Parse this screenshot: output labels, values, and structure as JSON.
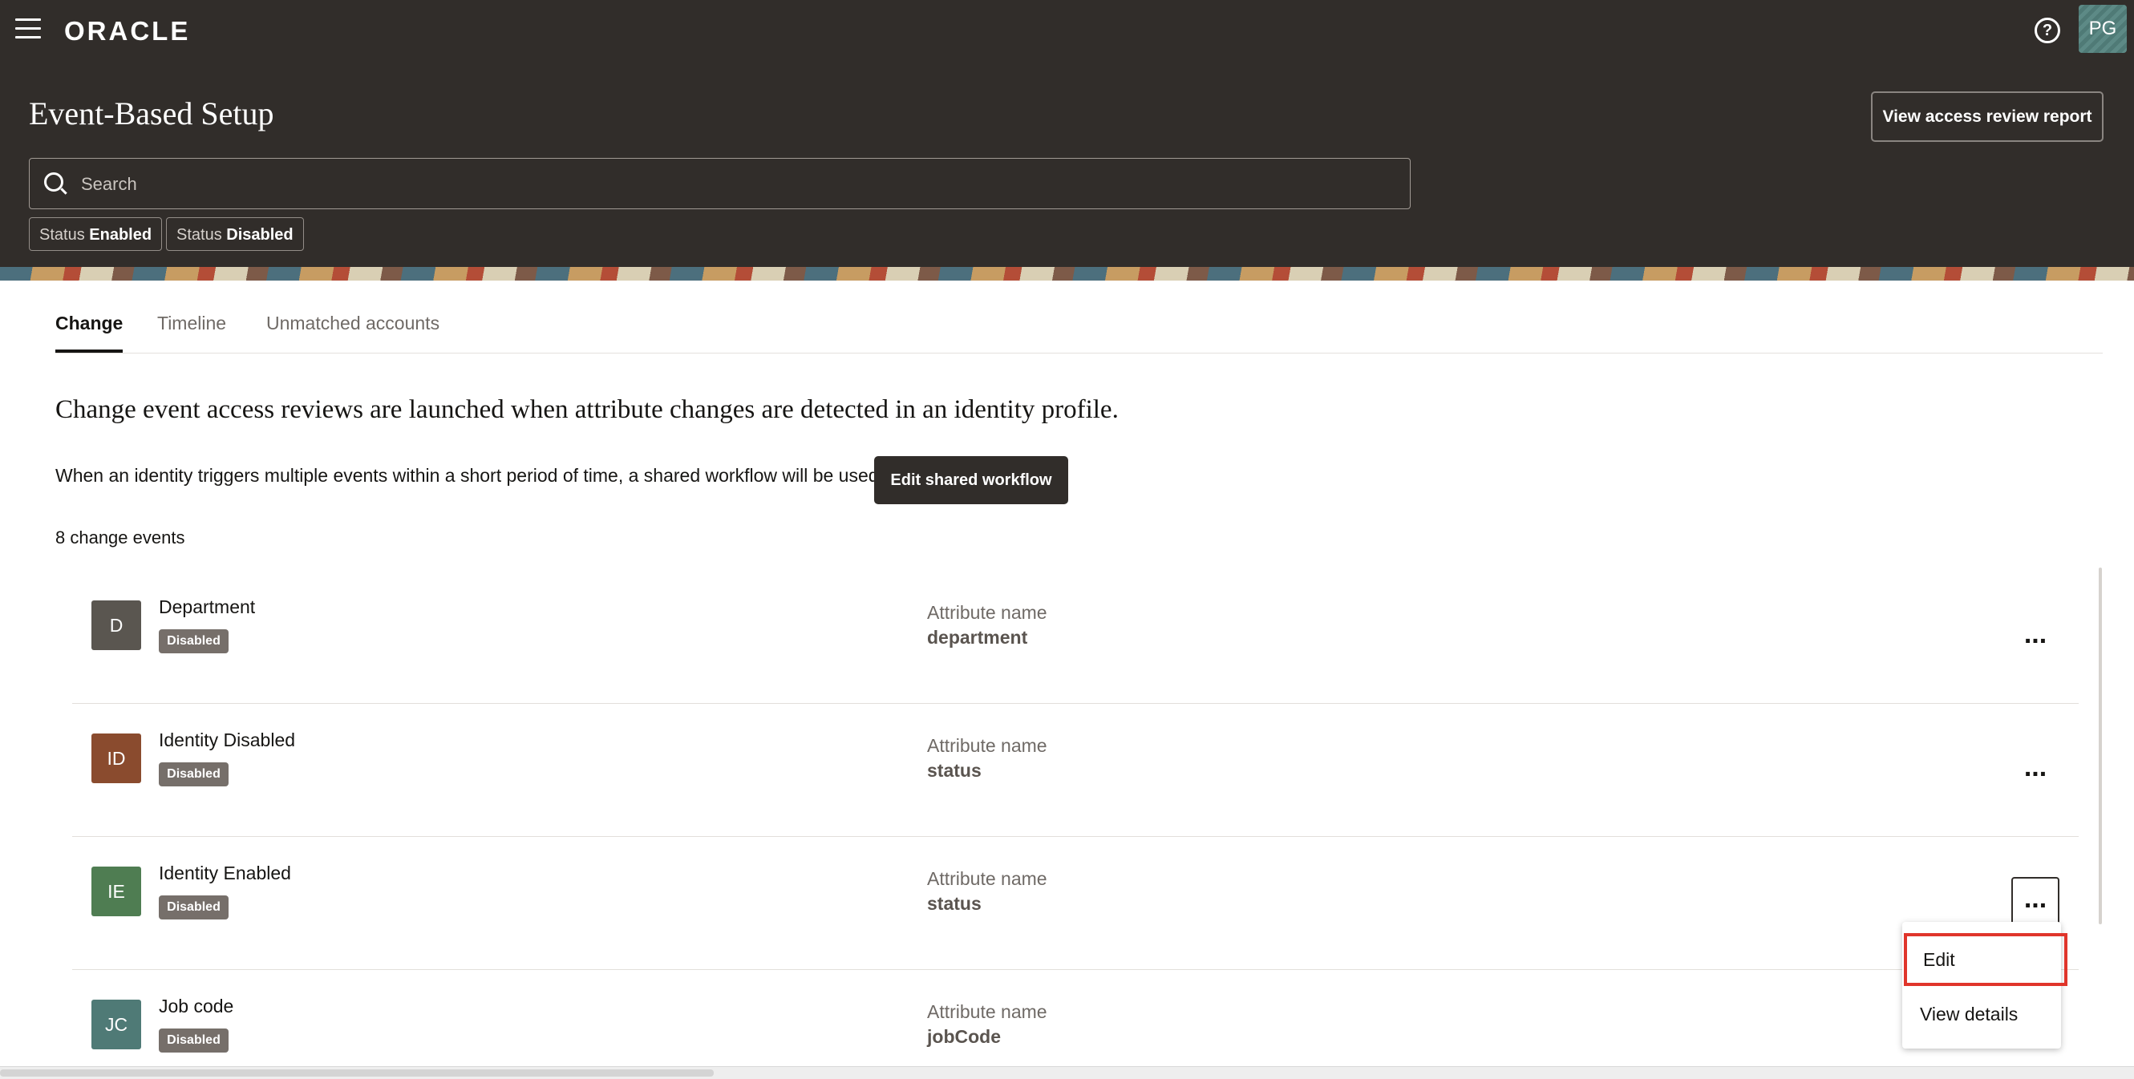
{
  "app": {
    "logo_text": "ORACLE",
    "help_icon": "?",
    "user_initials": "PG"
  },
  "header": {
    "title": "Event-Based Setup",
    "report_button_label": "View access review report",
    "search_placeholder": "Search",
    "filters": [
      {
        "key": "Status",
        "value": "Enabled"
      },
      {
        "key": "Status",
        "value": "Disabled"
      }
    ]
  },
  "tabs": [
    {
      "label": "Change",
      "active": true
    },
    {
      "label": "Timeline",
      "active": false
    },
    {
      "label": "Unmatched accounts",
      "active": false
    }
  ],
  "intro": {
    "heading": "Change event access reviews are launched when attribute changes are detected in an identity profile.",
    "workflow_text": "When an identity triggers multiple events within a short period of time, a shared workflow will be used.",
    "workflow_button_label": "Edit shared workflow",
    "count_text": "8 change events"
  },
  "events": [
    {
      "initials": "D",
      "name": "Department",
      "status": "Disabled",
      "attr_label": "Attribute name",
      "attr_value": "department",
      "color": "#5a5650"
    },
    {
      "initials": "ID",
      "name": "Identity Disabled",
      "status": "Disabled",
      "attr_label": "Attribute name",
      "attr_value": "status",
      "color": "#8a4b2e"
    },
    {
      "initials": "IE",
      "name": "Identity Enabled",
      "status": "Disabled",
      "attr_label": "Attribute name",
      "attr_value": "status",
      "color": "#4f7d52"
    },
    {
      "initials": "JC",
      "name": "Job code",
      "status": "Disabled",
      "attr_label": "Attribute name",
      "attr_value": "jobCode",
      "color": "#4f7a76"
    }
  ],
  "row_menu_icon": "...",
  "context_menu": {
    "items": [
      "Edit",
      "View details"
    ]
  }
}
